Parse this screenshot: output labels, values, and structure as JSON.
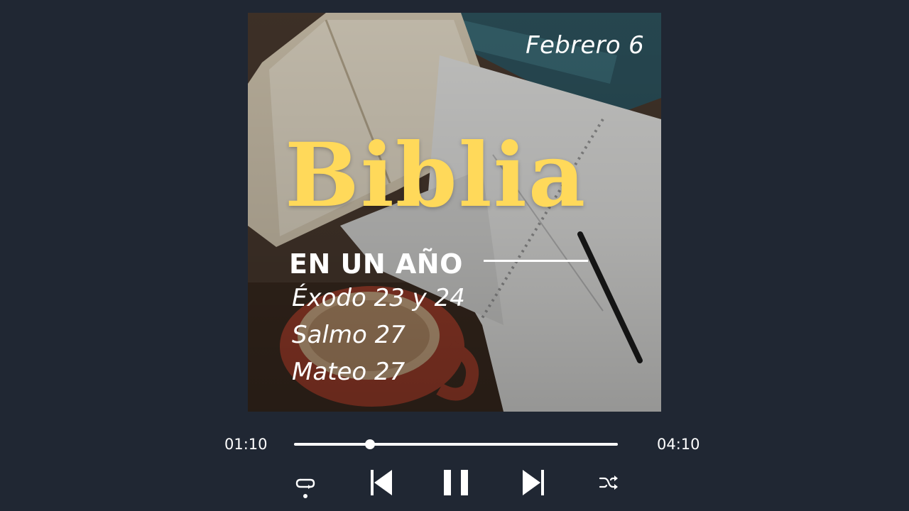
{
  "cover": {
    "date": "Febrero 6",
    "title": "Biblia",
    "subtitle": "EN UN AÑO",
    "readings": [
      "Éxodo 23 y 24",
      "Salmo 27",
      "Mateo 27"
    ]
  },
  "player": {
    "elapsed": "01:10",
    "total": "04:10",
    "progress_fraction": 0.235
  },
  "controls": {
    "repeat": "repeat-icon",
    "previous": "skip-previous-icon",
    "pause": "pause-icon",
    "next": "skip-next-icon",
    "shuffle": "shuffle-icon"
  },
  "colors": {
    "background": "#202733",
    "title_accent": "#FFD95A",
    "foreground": "#ffffff"
  }
}
